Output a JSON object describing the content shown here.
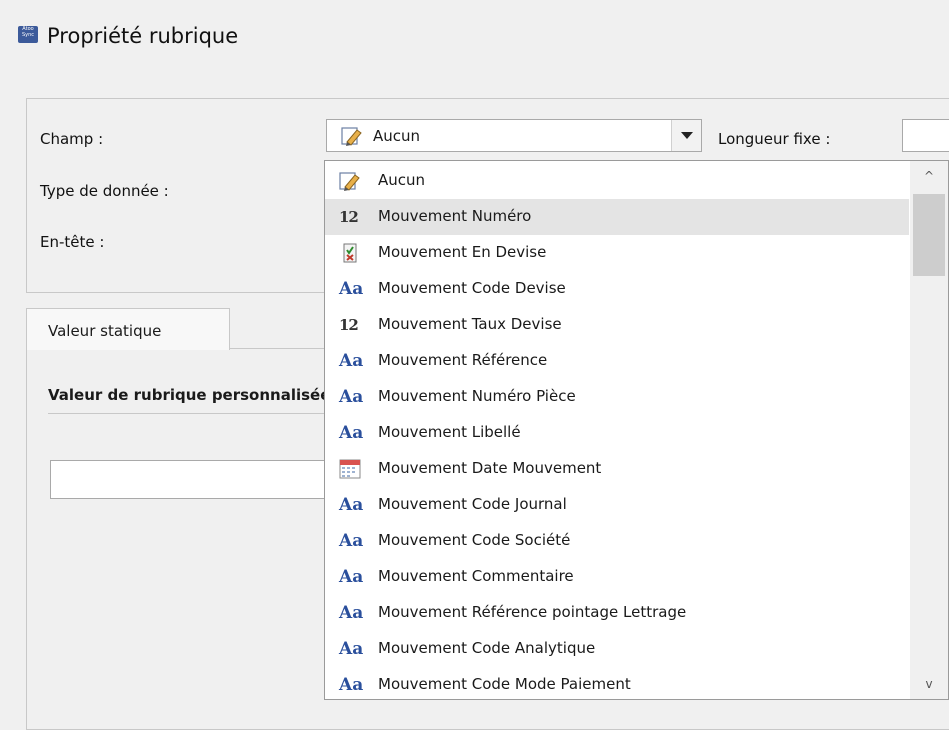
{
  "window": {
    "title": "Propriété rubrique",
    "icon": "app-icon"
  },
  "form": {
    "champ_label": "Champ :",
    "champ_value": "Aucun",
    "type_label": "Type de donnée :",
    "entete_label": "En-tête :",
    "longueur_label": "Longueur fixe :",
    "longueur_value": ""
  },
  "tabs": [
    {
      "label": "Valeur statique",
      "active": true
    }
  ],
  "panel": {
    "section_title": "Valeur de rubrique personnalisée",
    "static_value": ""
  },
  "dropdown": {
    "items": [
      {
        "label": "Aucun",
        "icon": "pencil-icon"
      },
      {
        "label": "Mouvement Numéro",
        "icon": "number-icon",
        "selected": true
      },
      {
        "label": "Mouvement En Devise",
        "icon": "checkbox-icon"
      },
      {
        "label": "Mouvement Code Devise",
        "icon": "text-icon"
      },
      {
        "label": "Mouvement Taux Devise",
        "icon": "number-icon"
      },
      {
        "label": "Mouvement Référence",
        "icon": "text-icon"
      },
      {
        "label": "Mouvement Numéro Pièce",
        "icon": "text-icon"
      },
      {
        "label": "Mouvement Libellé",
        "icon": "text-icon"
      },
      {
        "label": "Mouvement Date Mouvement",
        "icon": "calendar-icon"
      },
      {
        "label": "Mouvement Code Journal",
        "icon": "text-icon"
      },
      {
        "label": "Mouvement Code Société",
        "icon": "text-icon"
      },
      {
        "label": "Mouvement Commentaire",
        "icon": "text-icon"
      },
      {
        "label": "Mouvement Référence pointage Lettrage",
        "icon": "text-icon"
      },
      {
        "label": "Mouvement Code Analytique",
        "icon": "text-icon"
      },
      {
        "label": "Mouvement Code Mode Paiement",
        "icon": "text-icon"
      }
    ]
  },
  "glyphs": {
    "text": "Aa",
    "number": "12",
    "scroll_up": "^",
    "scroll_down": "v"
  }
}
